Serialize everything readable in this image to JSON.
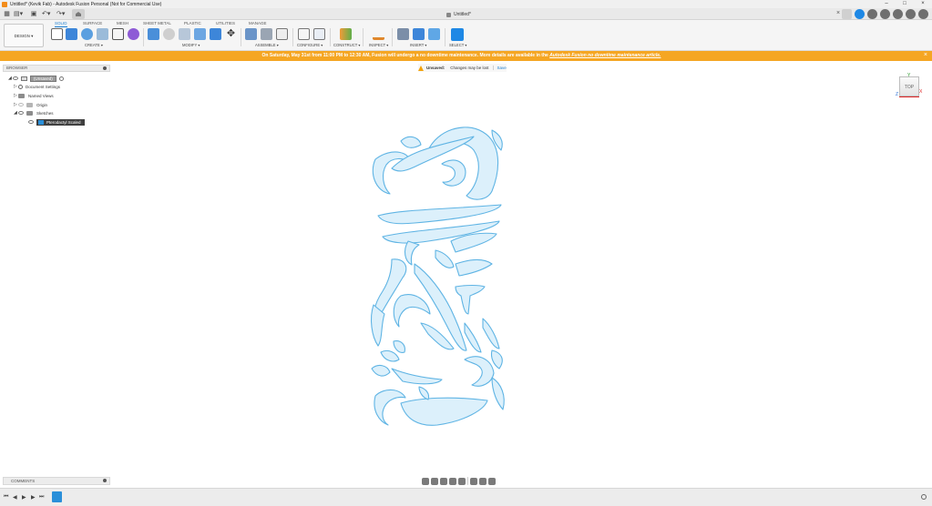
{
  "window": {
    "title": "Untitled* (Kevik Fab) - Autodesk Fusion Personal (Not for Commercial Use)",
    "controls": [
      "–",
      "□",
      "×"
    ]
  },
  "tabbar": {
    "doc_title": "Untitled*",
    "close": "×"
  },
  "toolbar": {
    "workspace": "DESIGN ▾",
    "mode_tabs": [
      "SOLID",
      "SURFACE",
      "MESH",
      "SHEET METAL",
      "PLASTIC",
      "UTILITIES",
      "MANAGE"
    ],
    "active_tab": "SOLID",
    "groups": [
      "CREATE ▾",
      "MODIFY ▾",
      "ASSEMBLE ▾",
      "CONFIGURE ▾",
      "CONSTRUCT ▾",
      "INSPECT ▾",
      "INSERT ▾",
      "SELECT ▾"
    ]
  },
  "banner": {
    "text": "On Saturday, May 31st from 11:00 PM to 12:30 AM, Fusion will undergo a no downtime maintenance. More details are available in the",
    "link": "Autodesk Fusion no downtime maintenance article.",
    "close": "×"
  },
  "browser": {
    "title": "BROWSER",
    "root": "(Unsaved)",
    "items": [
      {
        "label": "Document Settings"
      },
      {
        "label": "Named Views"
      },
      {
        "label": "Origin"
      },
      {
        "label": "Sketches"
      }
    ],
    "sketch": "Pterodactyl Scaled"
  },
  "unsaved": {
    "label": "Unsaved:",
    "message": "Changes may be lost",
    "save": "Save"
  },
  "viewcube": {
    "face": "TOP",
    "axis_x": "X",
    "axis_y": "Y",
    "axis_z": "Z"
  },
  "comments": {
    "title": "COMMENTS"
  },
  "timeline": {
    "controls": [
      "⏮",
      "◀",
      "▶",
      "▶",
      "⏭"
    ]
  },
  "colors": {
    "accent": "#1e7fd0",
    "banner": "#f5a623",
    "sketch_fill": "#dcf0fb",
    "sketch_stroke": "#5fb4e4"
  }
}
